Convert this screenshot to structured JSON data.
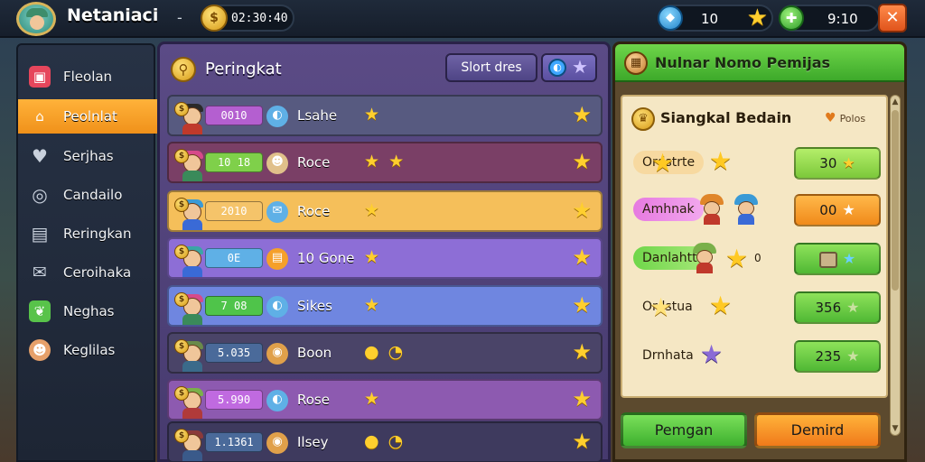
{
  "topbar": {
    "title": "Netaniaci",
    "dash": "-",
    "gold": "02:30:40",
    "gems": "10",
    "energy": "9:10",
    "close": "✕"
  },
  "sidebar": {
    "items": [
      {
        "label": "Fleolan",
        "icon": "shop-icon",
        "color": "#e6465c",
        "glyph": "▣"
      },
      {
        "label": "Peolnlat",
        "icon": "home-icon",
        "color": "#ffffff",
        "glyph": "⌂",
        "active": true
      },
      {
        "label": "Serjhas",
        "icon": "heart-icon",
        "color": "#c9d1dd",
        "glyph": "♥"
      },
      {
        "label": "Candailo",
        "icon": "target-icon",
        "color": "#c9d1dd",
        "glyph": "◎"
      },
      {
        "label": "Reringkan",
        "icon": "board-icon",
        "color": "#c9d1dd",
        "glyph": "▤"
      },
      {
        "label": "Ceroihaka",
        "icon": "mail-icon",
        "color": "#c9d1dd",
        "glyph": "✉"
      },
      {
        "label": "Neghas",
        "icon": "leaf-icon",
        "color": "#58c34a",
        "glyph": "❦"
      },
      {
        "label": "Keglilas",
        "icon": "profile-icon",
        "color": "#e6a06a",
        "glyph": "☻"
      }
    ]
  },
  "center": {
    "title": "Peringkat",
    "sort_label": "Slort dres",
    "rows": [
      {
        "score": "0010",
        "name": "Lsahe",
        "stars": "★",
        "bg": "#575a80",
        "pill": "#b45fd0",
        "cap": "#2a2a2a",
        "body": "#c0392b",
        "badge": "#5fb0e6",
        "badge_glyph": "◐"
      },
      {
        "score": "10 18",
        "name": "Roce",
        "stars": "★ ★",
        "bg": "#7a3f66",
        "pill": "#7fd04a",
        "cap": "#d64a8a",
        "body": "#3a8a5a",
        "badge": "#e0c08a",
        "badge_glyph": "☻"
      },
      {
        "score": "2010",
        "name": "Roce",
        "stars": "★",
        "bg": "#f5bf5a",
        "pill": "#f5c46a",
        "cap": "#3a9ad6",
        "body": "#3a6ad6",
        "badge": "#5fb0e6",
        "badge_glyph": "✉"
      },
      {
        "score": "0E",
        "name": "10 Gone",
        "stars": "★",
        "bg": "#8d6ed6",
        "pill": "#5fb0e6",
        "cap": "#3aa6a6",
        "body": "#3a6ad6",
        "badge": "#f5a02a",
        "badge_glyph": "▤"
      },
      {
        "score": "7 08",
        "name": "Sikes",
        "stars": "★",
        "bg": "#6f86e0",
        "pill": "#4fc44a",
        "cap": "#d64a8a",
        "body": "#3a8a5a",
        "badge": "#5fb0e6",
        "badge_glyph": "◐"
      },
      {
        "score": "5.035",
        "name": "Boon",
        "stars": "● ◔",
        "bg": "#4a4468",
        "pill": "#4a6a9a",
        "cap": "#6a8a4a",
        "body": "#3a6a8a",
        "badge": "#e0a04a",
        "badge_glyph": "◉"
      },
      {
        "score": "5.990",
        "name": "Rose",
        "stars": "★",
        "bg": "#8d5ab0",
        "pill": "#c06ae0",
        "cap": "#7ab04a",
        "body": "#b03a3a",
        "badge": "#5fb0e6",
        "badge_glyph": "◐"
      },
      {
        "score": "1.1361",
        "name": "Ilsey",
        "stars": "● ◔",
        "bg": "#3e3a5e",
        "pill": "#4a6a9a",
        "cap": "#8a3a3a",
        "body": "#3a5a8a",
        "badge": "#e0a04a",
        "badge_glyph": "◉"
      }
    ]
  },
  "right": {
    "title": "Nulnar Nomo Pemijas",
    "subtitle": "Siangkal Bedain",
    "side_label": "Polos",
    "rewards": [
      {
        "tag": "Ordstrte",
        "tag_bg": "#f7d9a0",
        "btn": "30",
        "btn_bg": "#8fd84a",
        "btn_star": "★"
      },
      {
        "tag": "Amhnak",
        "tag_bg": "#e67ae0",
        "btn": "00",
        "btn_bg": "#f5a02a",
        "btn_star": "★"
      },
      {
        "tag": "Danlahtti",
        "tag_bg": "#6fd64a",
        "btn": "",
        "btn_bg": "#5fd04a",
        "btn_star": "★"
      },
      {
        "tag": "Ordstua",
        "tag_bg": "transparent",
        "btn": "356",
        "btn_bg": "#5fd04a",
        "btn_star": "★"
      },
      {
        "tag": "Drnhata",
        "tag_bg": "transparent",
        "btn": "235",
        "btn_bg": "#5fd04a",
        "btn_star": "★"
      }
    ],
    "reward3_suffix": "0",
    "btn_left": "Pemgan",
    "btn_right": "Demird"
  }
}
